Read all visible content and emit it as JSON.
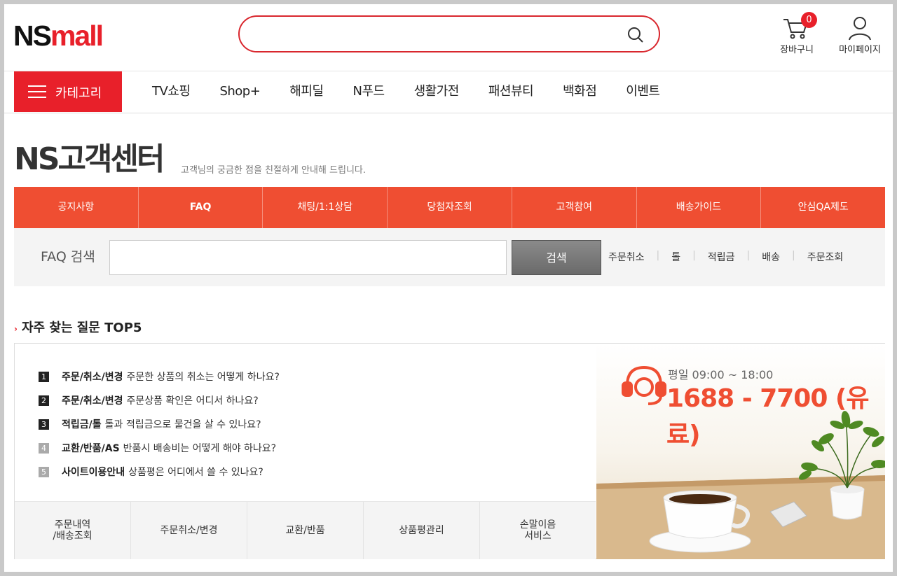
{
  "header": {
    "logo_ns": "NS",
    "logo_mall": "mall",
    "search_placeholder": "",
    "cart_label": "장바구니",
    "cart_count": "0",
    "mypage_label": "마이페이지"
  },
  "gnb": {
    "category_label": "카테고리",
    "items": [
      "TV쇼핑",
      "Shop+",
      "해피딜",
      "N푸드",
      "생활가전",
      "패션뷰티",
      "백화점",
      "이벤트"
    ]
  },
  "title": {
    "main": "NS고객센터",
    "sub": "고객님의 궁금한 점을 친절하게 안내해 드립니다."
  },
  "tabs": [
    "공지사항",
    "FAQ",
    "채팅/1:1상담",
    "당첨자조회",
    "고객참여",
    "배송가이드",
    "안심QA제도"
  ],
  "faq_search": {
    "label": "FAQ 검색",
    "value": "",
    "button": "검색",
    "keywords": [
      "주문취소",
      "톨",
      "적립금",
      "배송",
      "주문조회"
    ]
  },
  "top5": {
    "title": "자주 찾는 질문 TOP5",
    "items": [
      {
        "num": "1",
        "category": "주문/취소/변경",
        "question": "주문한 상품의 취소는 어떻게 하나요?"
      },
      {
        "num": "2",
        "category": "주문/취소/변경",
        "question": "주문상품 확인은 어디서 하나요?"
      },
      {
        "num": "3",
        "category": "적립금/톨",
        "question": "톨과 적립금으로 물건을 살 수 있나요?"
      },
      {
        "num": "4",
        "category": "교환/반품/AS",
        "question": "반품시 배송비는 어떻게 해야 하나요?"
      },
      {
        "num": "5",
        "category": "사이트이용안내",
        "question": "상품평은 어디에서 쓸 수 있나요?"
      }
    ],
    "quick_links": [
      "주문내역\n/배송조회",
      "주문취소/변경",
      "교환/반품",
      "상품평관리",
      "손말이음\n서비스"
    ]
  },
  "call_banner": {
    "hours": "평일 09:00 ~ 18:00",
    "phone": "1688 - 7700 (유료)"
  },
  "colors": {
    "brand_red": "#e8202a",
    "tab_orange": "#ef4e32"
  }
}
